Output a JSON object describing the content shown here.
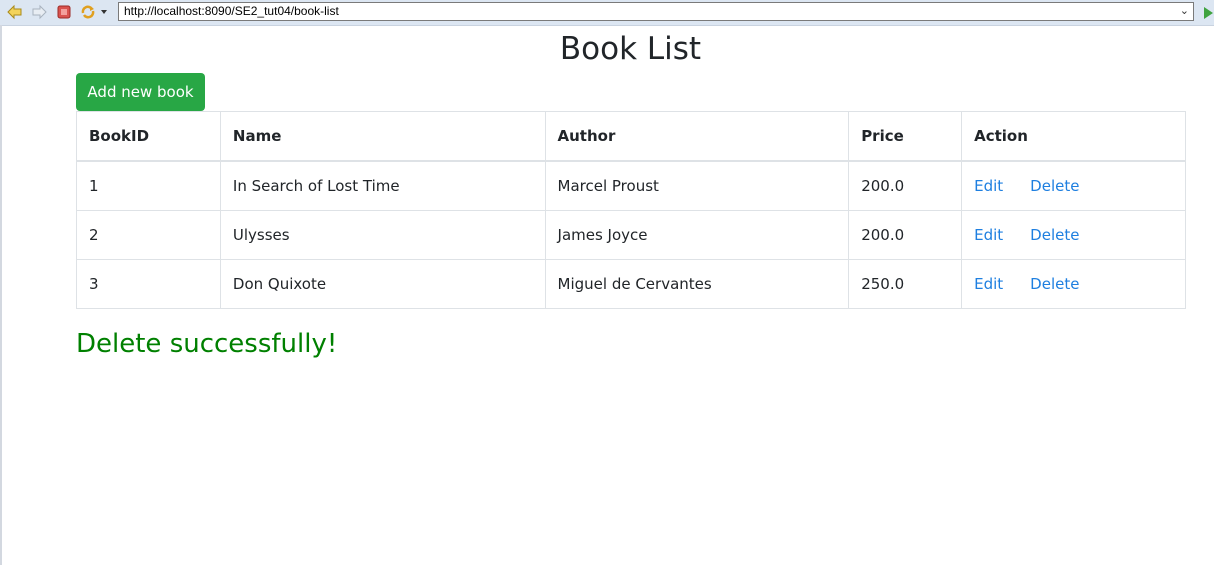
{
  "browser": {
    "url": "http://localhost:8090/SE2_tut04/book-list",
    "icons": [
      "back-arrow-icon",
      "forward-arrow-icon",
      "stop-icon",
      "refresh-icon",
      "dropdown-icon",
      "go-icon"
    ]
  },
  "page": {
    "title": "Book List",
    "add_button": "Add new book",
    "message": "Delete successfully!"
  },
  "table": {
    "headers": [
      "BookID",
      "Name",
      "Author",
      "Price",
      "Action"
    ],
    "rows": [
      {
        "id": "1",
        "name": "In Search of Lost Time",
        "author": "Marcel Proust",
        "price": "200.0",
        "edit": "Edit",
        "delete": "Delete"
      },
      {
        "id": "2",
        "name": "Ulysses",
        "author": "James Joyce",
        "price": "200.0",
        "edit": "Edit",
        "delete": "Delete"
      },
      {
        "id": "3",
        "name": "Don Quixote",
        "author": "Miguel de Cervantes",
        "price": "250.0",
        "edit": "Edit",
        "delete": "Delete"
      }
    ]
  },
  "colors": {
    "button_bg": "#28a745",
    "link": "#1e7fe0",
    "message": "#008000",
    "border": "#dee2e6"
  }
}
